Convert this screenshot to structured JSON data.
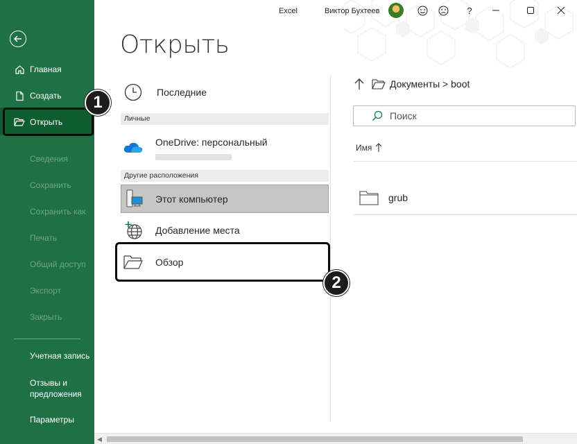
{
  "titlebar": {
    "app": "Excel",
    "user": "Виктор Бухтеев",
    "icons": [
      "smile-icon",
      "frown-icon",
      "help-icon",
      "minimize-icon",
      "maximize-icon",
      "close-icon"
    ]
  },
  "sidebar": {
    "primary": [
      {
        "label": "Главная",
        "icon": "home-icon"
      },
      {
        "label": "Создать",
        "icon": "new-document-icon"
      },
      {
        "label": "Открыть",
        "icon": "open-folder-icon"
      }
    ],
    "disabled": [
      "Сведения",
      "Сохранить",
      "Сохранить как",
      "Печать",
      "Общий доступ",
      "Экспорт",
      "Закрыть"
    ],
    "bottom": [
      "Учетная запись",
      "Отзывы и предложения",
      "Параметры"
    ]
  },
  "page": {
    "title": "Открыть"
  },
  "locations": {
    "recent": "Последние",
    "personal_header": "Личные",
    "onedrive": "OneDrive: персональный",
    "other_header": "Другие расположения",
    "this_pc": "Этот компьютер",
    "add_place": "Добавление места",
    "browse": "Обзор"
  },
  "right_pane": {
    "path": "Документы > boot",
    "search_placeholder": "Поиск",
    "column_name": "Имя",
    "files": [
      {
        "name": "grub",
        "icon": "folder-icon"
      }
    ]
  },
  "badges": [
    "1",
    "2"
  ],
  "colors": {
    "sidebar": "#1f7145",
    "sidebar_selected": "#0e5c30",
    "accent_green": "#107c41",
    "onedrive_blue": "#0f78d4"
  }
}
